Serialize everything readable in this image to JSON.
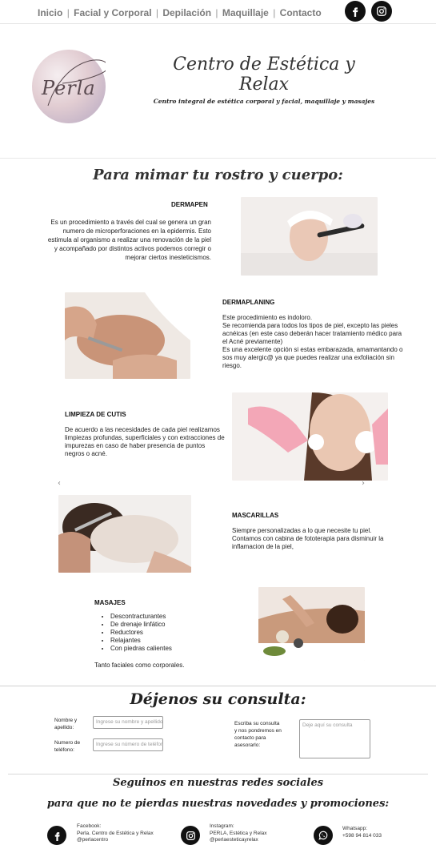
{
  "nav": {
    "items": [
      {
        "label": "Inicio"
      },
      {
        "label": "Facial y Corporal"
      },
      {
        "label": "Depilación"
      },
      {
        "label": "Maquillaje"
      },
      {
        "label": "Contacto"
      }
    ],
    "separator": "|",
    "social_icons": [
      "facebook-icon",
      "instagram-icon"
    ]
  },
  "header": {
    "logo_text": "Perla",
    "title": "Centro de Estética y Relax",
    "subtitle": "Centro integral de estética corporal y facial, maquillaje y masajes"
  },
  "services": {
    "heading": "Para mimar tu rostro y cuerpo:",
    "items": [
      {
        "title": "DERMAPEN",
        "text": "Es un procedimiento a través del cual se genera un gran numero de microperforaciones en la epidermis. Esto estimula al organismo a realizar una renovación de la piel y acompañado por distintos activos podemos corregir o mejorar ciertos inesteticismos."
      },
      {
        "title": "DERMAPLANING",
        "lines": [
          "Este procedimiento es indoloro.",
          "Se recomienda para todos los tipos de piel, excepto las pieles acnéicas (en este caso deberán hacer tratamiento médico para el Acné previamente)",
          "Es una excelente opción si estas embarazada, amamantando o sos muy alergic@ ya que puedes realizar una exfoliación sin riesgo."
        ]
      },
      {
        "title": "LIMPIEZA DE CUTIS",
        "text": "De acuerdo a las necesidades de cada piel realizamos limpiezas profundas, superficiales y con extracciones de impurezas en caso de haber presencia de puntos negros o acné."
      },
      {
        "title": "MASCARILLAS",
        "text": "Siempre personalizadas a lo que necesite tu piel. Contamos con cabina de fototerapia para disminuir la inflamacion de la piel,"
      },
      {
        "title": "MASAJES",
        "list": [
          "Descontracturantes",
          "De drenaje linfático",
          "Reductores",
          "Relajantes",
          "Con piedras calientes"
        ],
        "footer": "Tanto faciales como corporales."
      }
    ],
    "arrows": {
      "left": "‹",
      "right": "›"
    }
  },
  "contact": {
    "heading": "Déjenos su consulta:",
    "name_label": "Nombre y apellido:",
    "name_placeholder": "Ingrese su nombre y apellido",
    "phone_label": "Numero de teléfono:",
    "phone_placeholder": "Ingrese su número de teléfono",
    "message_label": "Escriba su consulta y nos pondremos en contacto para asesorarlo:",
    "message_placeholder": "Deje aquí su consulta"
  },
  "social": {
    "heading_line1": "Seguinos en nuestras redes sociales",
    "heading_line2": "para que no te pierdas nuestras novedades y promociones:",
    "facebook": {
      "label": "Facebook:",
      "line1": "Perla. Centro de Estética y Relax",
      "line2": "@perlacentro"
    },
    "instagram": {
      "label": "Instagram:",
      "line1": "PERLA, Estética y Relax",
      "line2": "@perlaesteticayrelax"
    },
    "whatsapp": {
      "label": "Whatsapp:",
      "line1": "+598 94 814 033"
    }
  },
  "colors": {
    "text": "#222222",
    "nav": "#7a7a7a",
    "icon_bg": "#111111"
  }
}
